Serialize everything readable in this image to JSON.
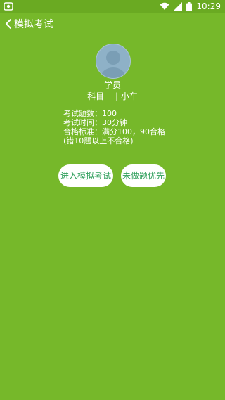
{
  "status_bar": {
    "time": "10:29"
  },
  "header": {
    "back_label": "模拟考试"
  },
  "profile": {
    "name": "学员",
    "subject": "科目一 | 小车"
  },
  "exam_info": {
    "count": "考试题数：100",
    "time": "考试时间：30分钟",
    "pass_standard": "合格标准：满分100，90合格",
    "note": "(错10题以上不合格)"
  },
  "actions": {
    "start_label": "进入模拟考试",
    "undone_first_label": "未做题优先"
  },
  "colors": {
    "background": "#76b82a",
    "button_text": "#2f9f5c"
  }
}
